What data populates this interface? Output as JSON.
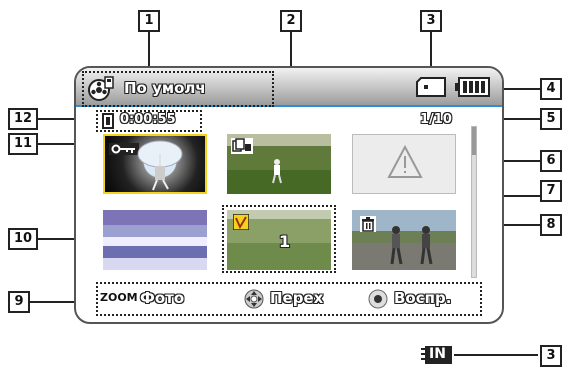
{
  "header": {
    "mode_label": "По умолч",
    "mode_icon": "film-reel-icon",
    "storage_icon": "memory-card-icon",
    "battery_icon": "battery-full-icon"
  },
  "status": {
    "time_icon": "clip-icon",
    "total_time": "0:00:55",
    "page": "1/10"
  },
  "thumbnails": [
    {
      "name": "protected-clip",
      "icons": [
        "key-icon"
      ],
      "selected": true
    },
    {
      "name": "print-marked-clip",
      "icons": [
        "dpof-icon"
      ],
      "selected": false
    },
    {
      "name": "damaged-clip",
      "icons": [
        "warning-icon"
      ],
      "selected": false
    },
    {
      "name": "landscape-clip",
      "icons": [],
      "selected": false
    },
    {
      "name": "multi-selected-clip",
      "icons": [
        "check-v-icon"
      ],
      "count": "1",
      "selected": false
    },
    {
      "name": "delete-marked-clip",
      "icons": [
        "trash-icon"
      ],
      "selected": false
    }
  ],
  "footer": {
    "zoom_badge": "ZOOM",
    "zoom_label": "Фото",
    "move_label": "Перех",
    "play_label": "Воспр."
  },
  "callouts": [
    "1",
    "2",
    "3",
    "4",
    "5",
    "6",
    "7",
    "8",
    "9",
    "10",
    "11",
    "12",
    "3"
  ],
  "bottom_indicator": {
    "badge": "IN"
  },
  "colors": {
    "accent_line": "#2b8ed6",
    "selected_border": "#f5d21e"
  }
}
